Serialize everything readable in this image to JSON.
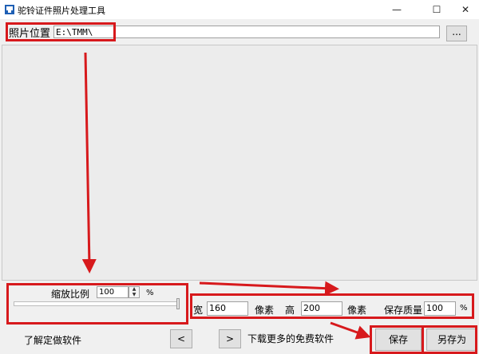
{
  "window": {
    "title": "驼铃证件照片处理工具",
    "minimize_glyph": "—",
    "maximize_glyph": "☐",
    "close_glyph": "✕"
  },
  "toolbar": {
    "path_label": "照片位置",
    "path_value": "E:\\TMM\\",
    "browse_label": "..."
  },
  "scale": {
    "label": "缩放比例",
    "value": "100",
    "unit": "%",
    "slider_fraction": 1.0
  },
  "size": {
    "width_label": "宽",
    "width_value": "160",
    "width_unit": "像素",
    "height_label": "高",
    "height_value": "200",
    "height_unit": "像素"
  },
  "quality": {
    "label": "保存质量",
    "value": "100",
    "unit": "%"
  },
  "footer": {
    "learn_link": "了解定做软件",
    "prev_label": "<",
    "next_label": ">",
    "download_link": "下载更多的免费软件",
    "save_label": "保存",
    "saveas_label": "另存为"
  },
  "colors": {
    "annotation_red": "#d7191c",
    "app_icon_blue": "#1e5fb4"
  }
}
